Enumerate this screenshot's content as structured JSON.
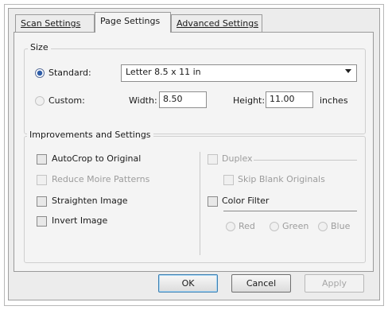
{
  "tabs": [
    {
      "label": "Scan Settings"
    },
    {
      "label": "Page Settings"
    },
    {
      "label": "Advanced Settings"
    }
  ],
  "size": {
    "legend": "Size",
    "standard_label": "Standard:",
    "standard_value": "Letter 8.5 x 11 in",
    "custom_label": "Custom:",
    "width_label": "Width:",
    "width_value": "8.50",
    "height_label": "Height:",
    "height_value": "11.00",
    "units": "inches"
  },
  "improvements": {
    "legend": "Improvements and Settings",
    "autocrop": "AutoCrop to Original",
    "reduce_moire": "Reduce Moire Patterns",
    "straighten": "Straighten Image",
    "invert": "Invert Image",
    "duplex": "Duplex",
    "skip_blank": "Skip Blank Originals",
    "color_filter": "Color Filter",
    "red": "Red",
    "green": "Green",
    "blue": "Blue"
  },
  "buttons": {
    "ok": "OK",
    "cancel": "Cancel",
    "apply": "Apply"
  }
}
